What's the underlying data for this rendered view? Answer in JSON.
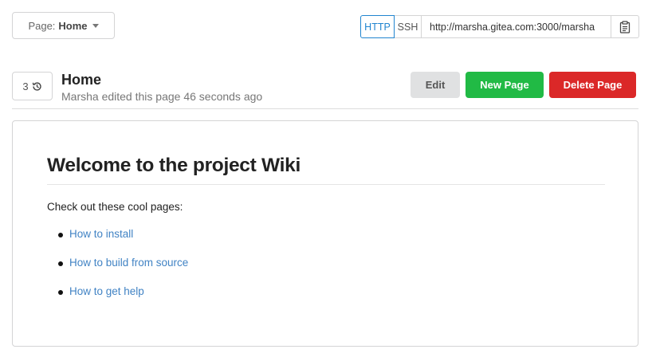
{
  "page_selector": {
    "prefix": "Page:",
    "value": "Home"
  },
  "clone": {
    "http_label": "HTTP",
    "ssh_label": "SSH",
    "selected": "HTTP",
    "url": "http://marsha.gitea.com:3000/marsha"
  },
  "revisions": {
    "count": "3"
  },
  "page": {
    "title": "Home",
    "meta": "Marsha edited this page 46 seconds ago"
  },
  "actions": {
    "edit_label": "Edit",
    "new_label": "New Page",
    "delete_label": "Delete Page"
  },
  "content": {
    "heading": "Welcome to the project Wiki",
    "intro": "Check out these cool pages:",
    "links": [
      "How to install",
      "How to build from source",
      "How to get help"
    ]
  },
  "colors": {
    "link": "#4183c4",
    "primary": "#2185d0",
    "green": "#21ba45",
    "red": "#db2828",
    "grey_button": "#e0e1e2"
  }
}
